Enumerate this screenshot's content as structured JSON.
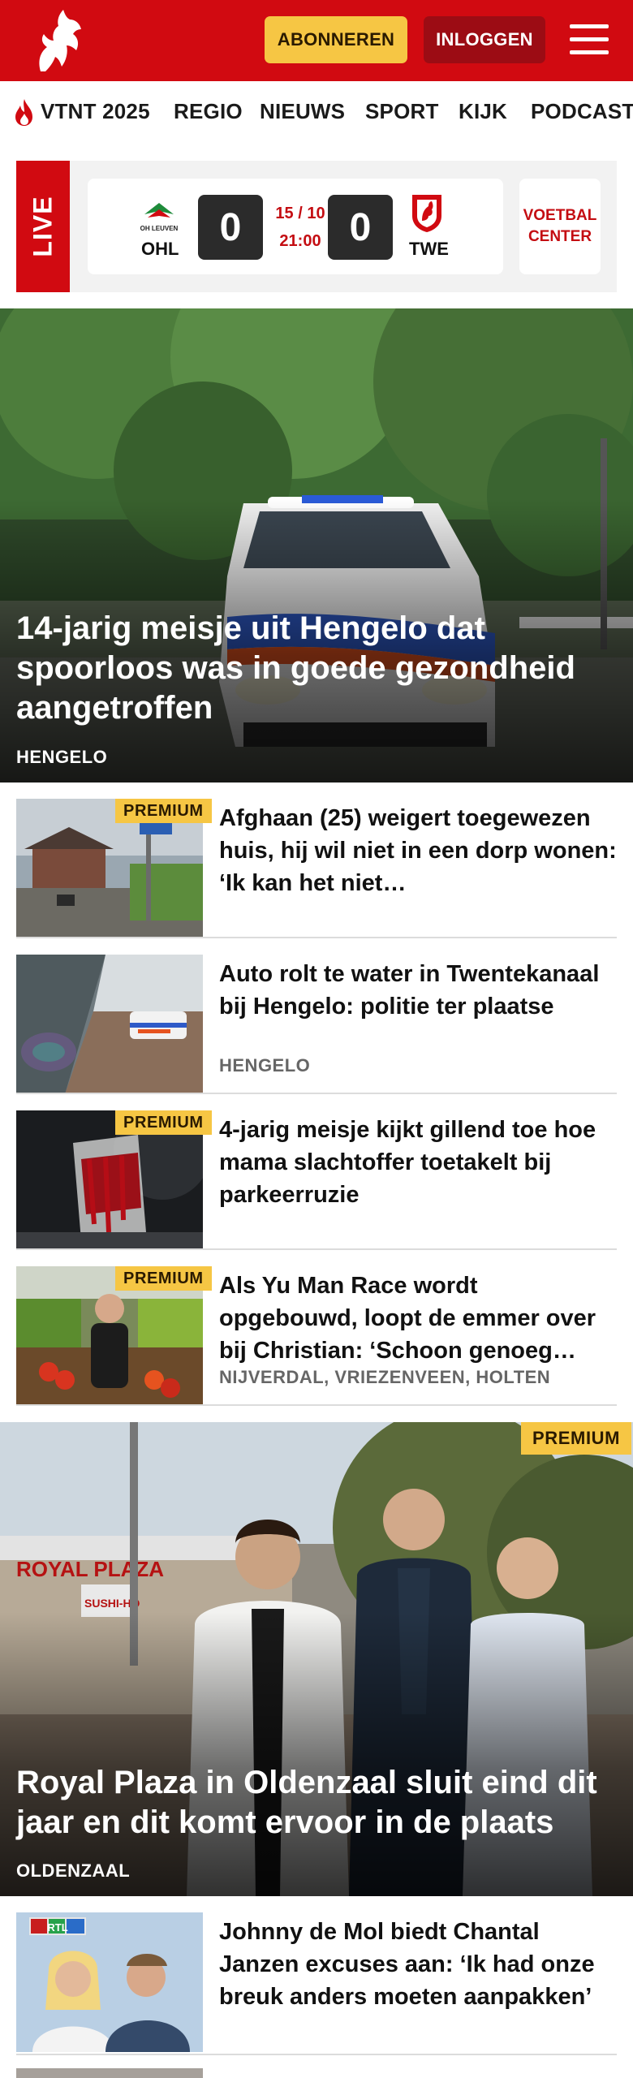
{
  "header": {
    "brand_colors": {
      "primary": "#d10a11",
      "subscribe": "#f6c644",
      "login": "#9c0c14",
      "premium": "#f6c644"
    },
    "subscribe_label": "ABONNEREN",
    "login_label": "INLOGGEN",
    "menu_icon": "hamburger-icon",
    "logo_icon": "tubantia-horse-icon"
  },
  "nav": {
    "items": [
      {
        "label": "VTNT 2025",
        "icon": "flame-icon"
      },
      {
        "label": "REGIO"
      },
      {
        "label": "NIEUWS"
      },
      {
        "label": "SPORT"
      },
      {
        "label": "KIJK"
      },
      {
        "label": "PODCAST"
      }
    ]
  },
  "live": {
    "tag": "LIVE",
    "home": {
      "abbr": "OHL",
      "logo_text": "OH LEUVEN",
      "score": "0"
    },
    "away": {
      "abbr": "TWE",
      "score": "0"
    },
    "date": "15 / 10",
    "time": "21:00",
    "center_line1": "VOETBAL",
    "center_line2": "CENTER"
  },
  "articles": {
    "hero1": {
      "title": "14-jarig meisje uit Hengelo dat spoorloos was in goede gezondheid aangetroffen",
      "location": "HENGELO"
    },
    "list1": [
      {
        "premium": "PREMIUM",
        "title": "Afghaan (25) weigert toegewezen huis, hij wil niet in een dorp wonen: ‘Ik kan het niet…",
        "location": ""
      },
      {
        "premium": "",
        "title": "Auto rolt te water in Twentekanaal bij Hengelo: politie ter plaatse",
        "location": "HENGELO"
      },
      {
        "premium": "PREMIUM",
        "title": "4-jarig meisje kijkt gillend toe hoe mama slachtoffer toetakelt bij parkeerruzie",
        "location": ""
      },
      {
        "premium": "PREMIUM",
        "title": "Als Yu Man Race wordt opgebouwd, loopt de emmer over bij Christian: ‘Schoon genoeg…",
        "location": "NIJVERDAL, VRIEZENVEEN, HOLTEN"
      }
    ],
    "hero2": {
      "premium": "PREMIUM",
      "title": "Royal Plaza in Oldenzaal sluit eind dit jaar en dit komt ervoor in de plaats",
      "location": "OLDENZAAL",
      "sign_text": "ROYAL PLAZA",
      "sushi_text": "SUSHI-HO"
    },
    "list2": [
      {
        "premium": "",
        "title": "Johnny de Mol biedt Chantal Janzen excuses aan: ‘Ik had onze breuk anders moeten aanpakken’",
        "location": "",
        "badge": "RTL"
      }
    ]
  }
}
